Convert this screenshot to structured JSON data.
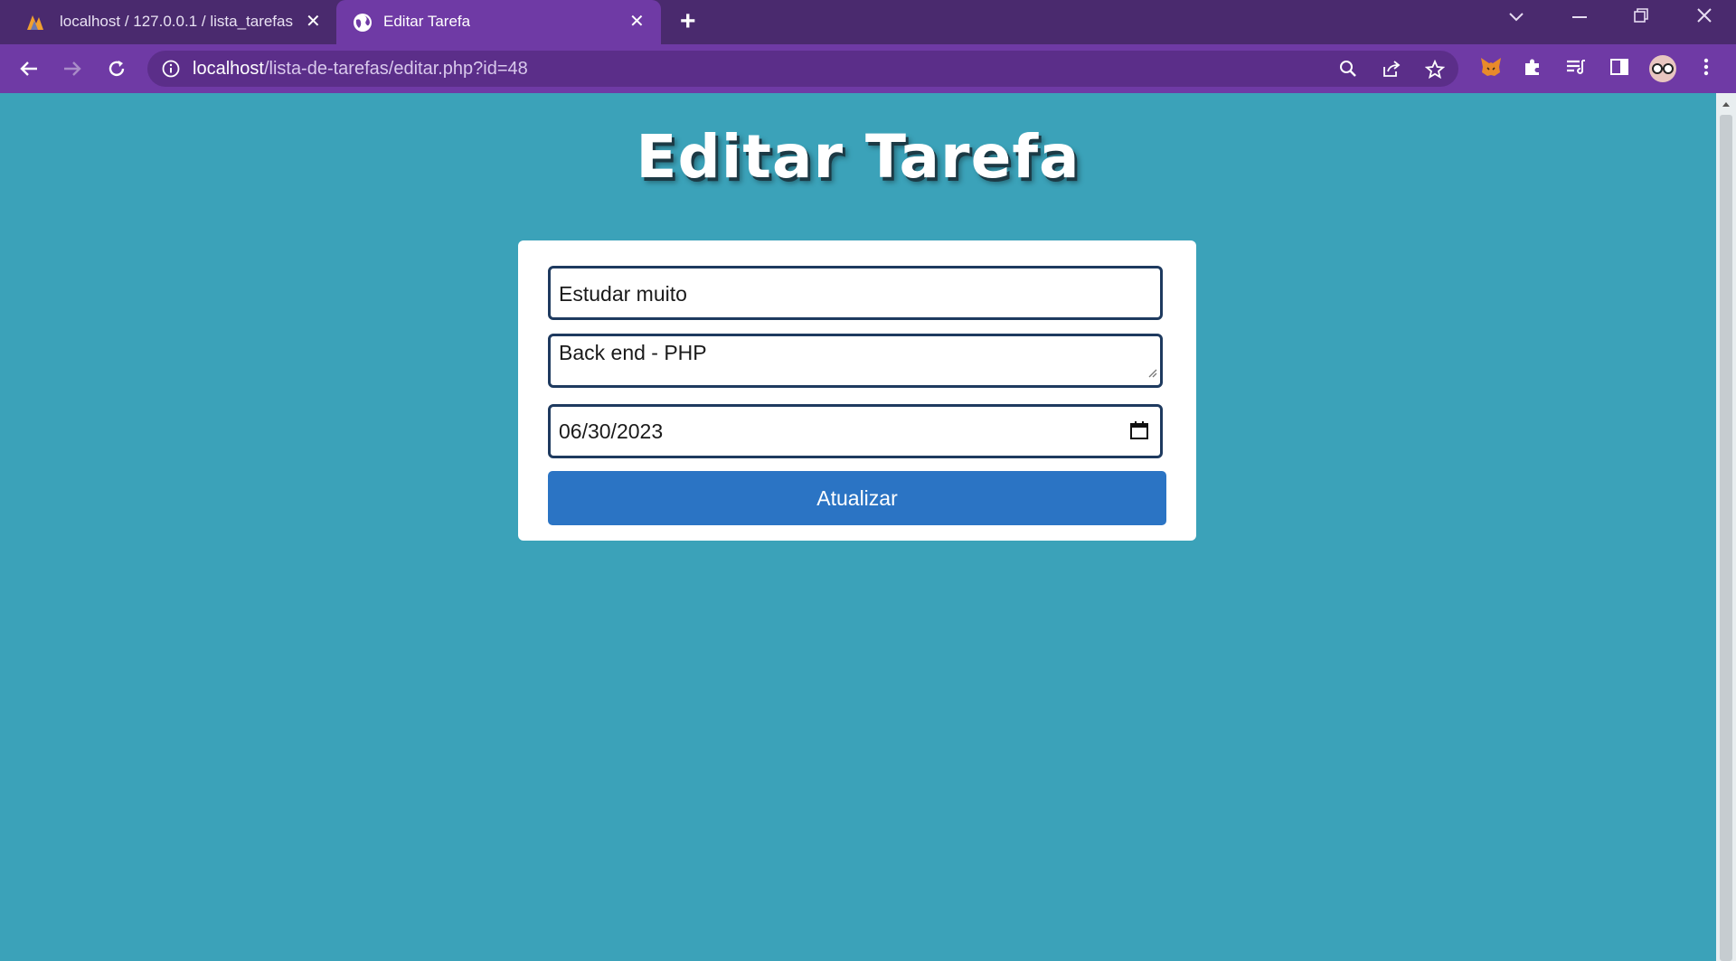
{
  "browser": {
    "tabs": [
      {
        "title": "localhost / 127.0.0.1 / lista_tarefas",
        "active": false,
        "icon": "phpmyadmin-logo"
      },
      {
        "title": "Editar Tarefa",
        "active": true,
        "icon": "globe-icon"
      }
    ],
    "url_host": "localhost",
    "url_path": "/lista-de-tarefas/editar.php?id=48"
  },
  "page": {
    "heading": "Editar Tarefa",
    "form": {
      "title_value": "Estudar muito",
      "description_value": "Back end - PHP",
      "date_value": "06/30/2023",
      "submit_label": "Atualizar"
    }
  },
  "colors": {
    "page_background": "#3ba2b9",
    "browser_frame": "#6f3aa5",
    "button": "#2b74c4"
  }
}
